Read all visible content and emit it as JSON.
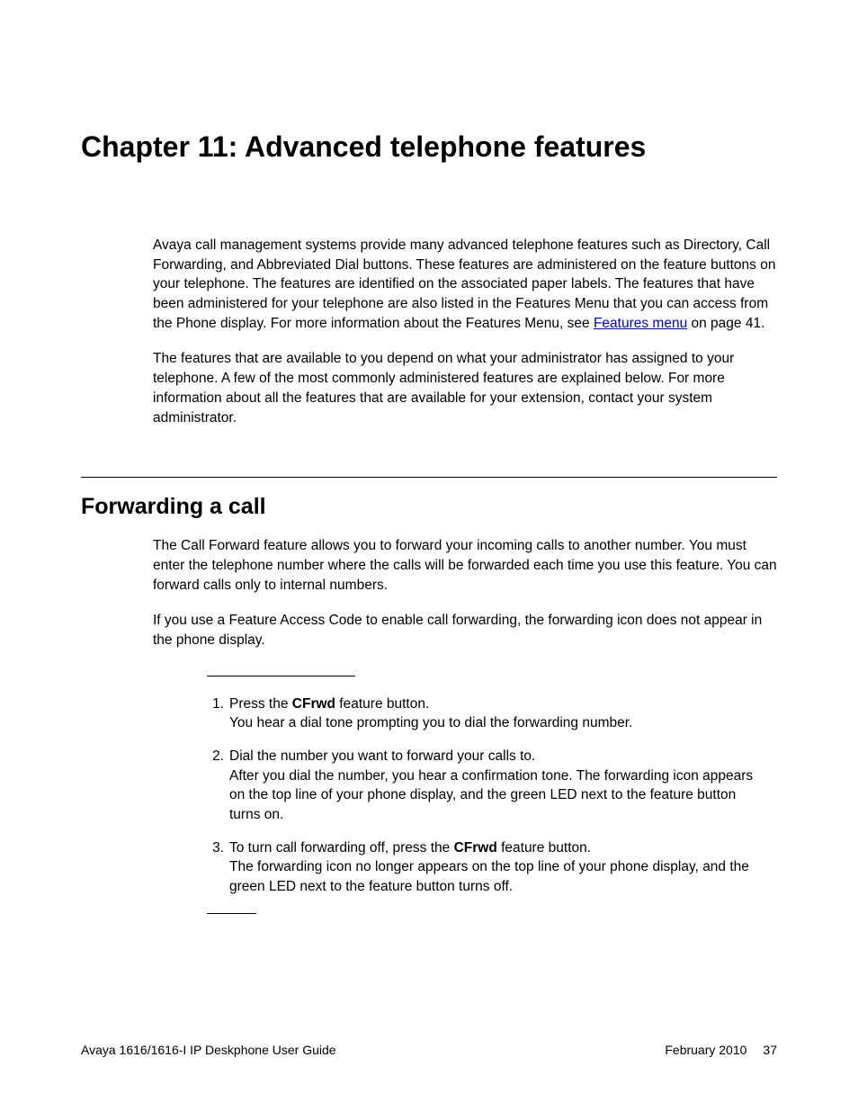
{
  "chapter": {
    "title": "Chapter 11: Advanced telephone features"
  },
  "intro": {
    "para1_before_link": "Avaya call management systems provide many advanced telephone features such as Directory, Call Forwarding, and Abbreviated Dial buttons. These features are administered on the feature buttons on your telephone. The features are identified on the associated paper labels. The features that have been administered for your telephone are also listed in the Features Menu that you can access from the Phone display. For more information about the Features Menu, see ",
    "link_text": "Features menu",
    "para1_after_link": " on page 41.",
    "para2": "The features that are available to you depend on what your administrator has assigned to your telephone. A few of the most commonly administered features are explained below. For more information about all the features that are available for your extension, contact your system administrator."
  },
  "section": {
    "title": "Forwarding a call",
    "para1": "The Call Forward feature allows you to forward your incoming calls to another number. You must enter the telephone number where the calls will be forwarded each time you use this feature. You can forward calls only to internal numbers.",
    "para2": "If you use a Feature Access Code to enable call forwarding, the forwarding icon does not appear in the phone display.",
    "steps": [
      {
        "num": "1.",
        "line1_before_bold": "Press the ",
        "line1_bold": "CFrwd",
        "line1_after_bold": " feature button.",
        "line2": "You hear a dial tone prompting you to dial the forwarding number."
      },
      {
        "num": "2.",
        "line1": "Dial the number you want to forward your calls to.",
        "line2": "After you dial the number, you hear a confirmation tone. The forwarding icon appears on the top line of your phone display, and the green LED next to the feature button turns on."
      },
      {
        "num": "3.",
        "line1_before_bold": "To turn call forwarding off, press the ",
        "line1_bold": "CFrwd",
        "line1_after_bold": " feature button.",
        "line2": "The forwarding icon no longer appears on the top line of your phone display, and the green LED next to the feature button turns off."
      }
    ]
  },
  "footer": {
    "left": "Avaya 1616/1616-I IP Deskphone User Guide",
    "date": "February 2010",
    "page": "37"
  }
}
